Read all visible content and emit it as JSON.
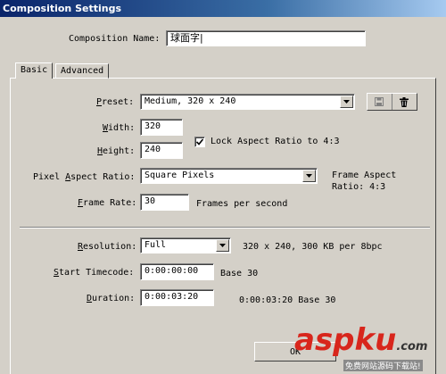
{
  "window": {
    "title": "Composition Settings"
  },
  "composition_name": {
    "label": "Composition Name:",
    "value": "球面字|"
  },
  "tabs": [
    {
      "label": "Basic"
    },
    {
      "label": "Advanced"
    }
  ],
  "preset": {
    "label": "Preset:",
    "value": "Medium, 320 x 240",
    "icons": [
      "save-icon",
      "trash-icon"
    ]
  },
  "width": {
    "label": "Width:",
    "value": "320"
  },
  "height": {
    "label": "Height:",
    "value": "240"
  },
  "lock_aspect": {
    "label": "Lock Aspect Ratio to 4:3",
    "checked": true
  },
  "pixel_aspect": {
    "label": "Pixel Aspect Ratio:",
    "value": "Square Pixels",
    "frame_aspect_line1": "Frame Aspect",
    "frame_aspect_line2": "Ratio: 4:3"
  },
  "frame_rate": {
    "label": "Frame Rate:",
    "value": "30",
    "unit": "Frames per second"
  },
  "resolution": {
    "label": "Resolution:",
    "value": "Full",
    "info": "320 x 240, 300 KB per 8bpc"
  },
  "start_timecode": {
    "label": "Start Timecode:",
    "value": "0:00:00:00",
    "base": "Base 30"
  },
  "duration": {
    "label": "Duration:",
    "value": "0:00:03:20",
    "info": "0:00:03:20 Base 30"
  },
  "ok_button": {
    "label": "OK"
  },
  "watermark": {
    "text": "aspku",
    "tld": ".com",
    "subtext": "免费网站源码下载站!"
  }
}
